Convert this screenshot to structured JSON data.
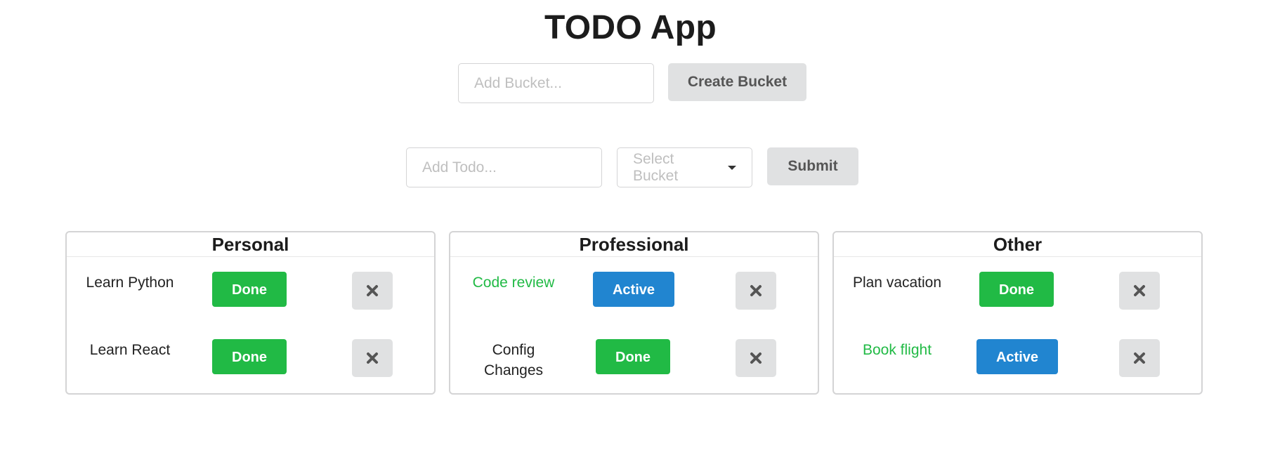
{
  "header": {
    "title": "TODO App"
  },
  "bucket_form": {
    "input_placeholder": "Add Bucket...",
    "button_label": "Create Bucket"
  },
  "todo_form": {
    "input_placeholder": "Add Todo...",
    "select_placeholder": "Select Bucket",
    "button_label": "Submit"
  },
  "buckets": [
    {
      "name": "Personal",
      "todos": [
        {
          "text": "Learn Python",
          "status": "Done",
          "completed": false
        },
        {
          "text": "Learn React",
          "status": "Done",
          "completed": false
        }
      ]
    },
    {
      "name": "Professional",
      "todos": [
        {
          "text": "Code review",
          "status": "Active",
          "completed": true
        },
        {
          "text": "Config Changes",
          "status": "Done",
          "completed": false
        }
      ]
    },
    {
      "name": "Other",
      "todos": [
        {
          "text": "Plan vacation",
          "status": "Done",
          "completed": false
        },
        {
          "text": "Book flight",
          "status": "Active",
          "completed": true
        }
      ]
    }
  ],
  "icons": {
    "delete": "close-icon",
    "select_caret": "caret-down-icon"
  },
  "colors": {
    "done": "#21ba45",
    "active": "#2185d0",
    "completed_text": "#21ba45"
  }
}
